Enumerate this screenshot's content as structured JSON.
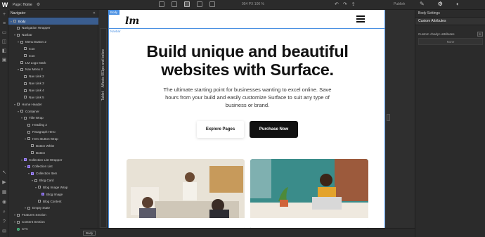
{
  "topbar": {
    "logo": "W",
    "page_prefix": "Page:",
    "page_name": "Home",
    "size_text": "954 PX 100 %",
    "publish_label": "Publish"
  },
  "navigator": {
    "title": "Navigator",
    "items": [
      {
        "label": "Body"
      },
      {
        "label": "Navigation Wrapper"
      },
      {
        "label": "Navbar"
      },
      {
        "label": "Menu Button 2"
      },
      {
        "label": "Icon"
      },
      {
        "label": "Icon"
      },
      {
        "label": "LM Logo Mark"
      },
      {
        "label": "Nav Menu 2"
      },
      {
        "label": "Nav Link 2"
      },
      {
        "label": "Nav Link 3"
      },
      {
        "label": "Nav Link 4"
      },
      {
        "label": "Nav Link 5"
      },
      {
        "label": "Home Header"
      },
      {
        "label": "Container"
      },
      {
        "label": "Title Wrap"
      },
      {
        "label": "Heading 2"
      },
      {
        "label": "Paragraph Hero"
      },
      {
        "label": "Hero Button Wrap"
      },
      {
        "label": "Button White"
      },
      {
        "label": "Button"
      },
      {
        "label": "Collection List Wrapper"
      },
      {
        "label": "Collection List"
      },
      {
        "label": "Collection Item"
      },
      {
        "label": "Blog Card"
      },
      {
        "label": "Blog Image Wrap"
      },
      {
        "label": "Blog Image"
      },
      {
        "label": "Blog Content"
      },
      {
        "label": "Empty State"
      },
      {
        "label": "Features Section"
      },
      {
        "label": "Content Section"
      },
      {
        "label": "CTA"
      }
    ]
  },
  "canvas": {
    "body_tag": "Body",
    "navbar_tag": "Navbar",
    "breakpoint_label": "Tablet",
    "breakpoint_note": "Affects 991px and below",
    "hero_title": "Build unique and beautiful websites with Surface.",
    "hero_subtitle": "The ultimate starting point for businesses wanting to excel online. Save hours from your build and easily customize Surface to suit any type of business or brand.",
    "btn_explore": "Explore Pages",
    "btn_purchase": "Purchase Now",
    "breadcrumb": "Body"
  },
  "right_panel": {
    "header": "Body Settings",
    "section": "Custom Attributes",
    "attr_label": "Custom <body> attributes",
    "none_label": "None"
  },
  "colors": {
    "accent": "#4a90e2",
    "selection": "#3a5d8f",
    "panel": "#2b2b2b"
  }
}
